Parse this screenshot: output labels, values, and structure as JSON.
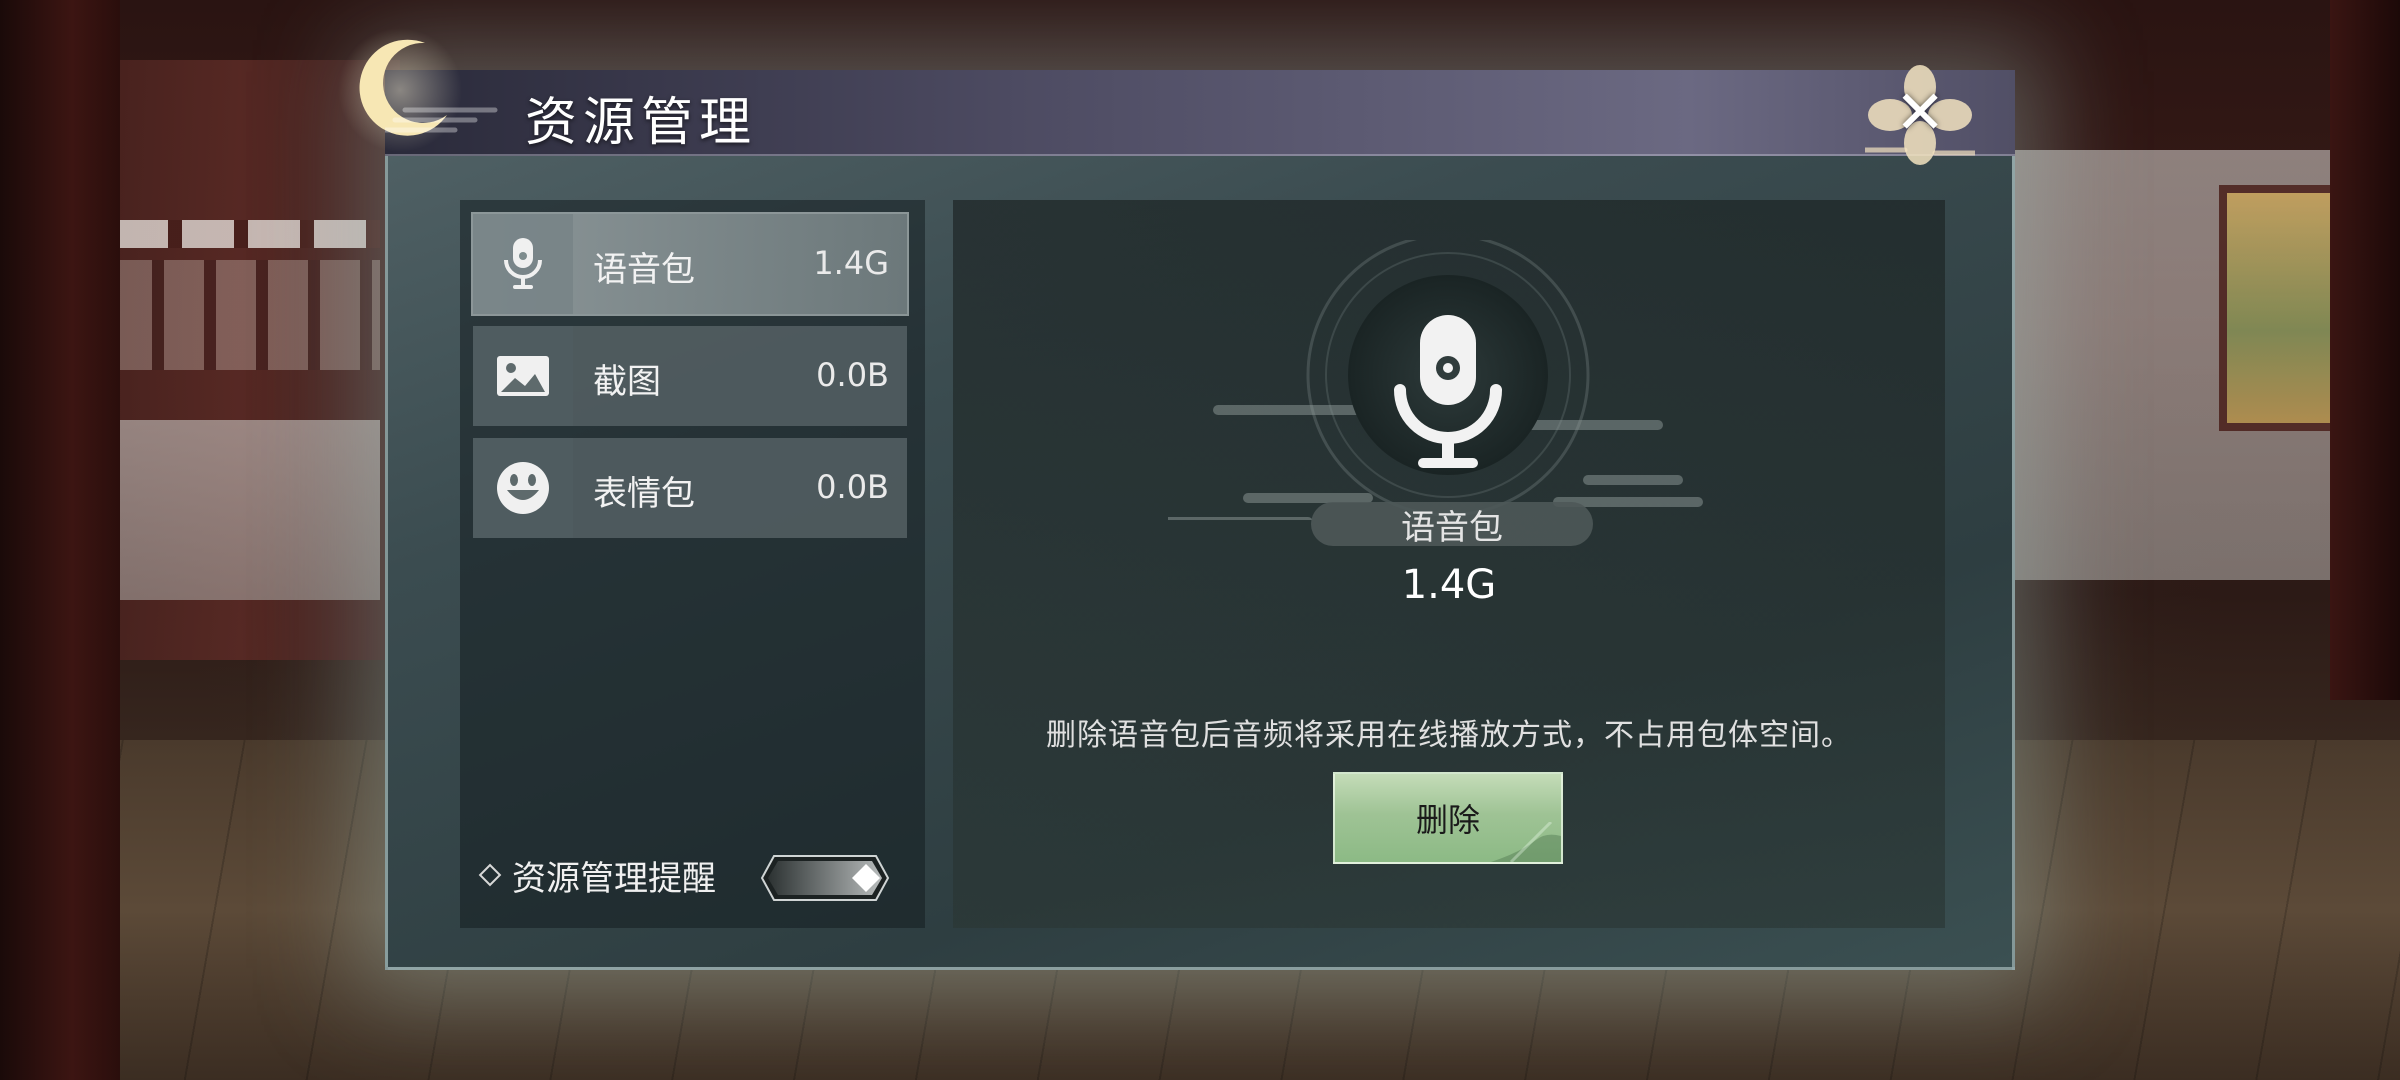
{
  "dialog": {
    "title": "资源管理",
    "close_label": "✕"
  },
  "resource_list": [
    {
      "label": "语音包",
      "size": "1.4G",
      "icon": "microphone-icon",
      "selected": true
    },
    {
      "label": "截图",
      "size": "0.0B",
      "icon": "image-icon",
      "selected": false
    },
    {
      "label": "表情包",
      "size": "0.0B",
      "icon": "smiley-icon",
      "selected": false
    }
  ],
  "reminder": {
    "label": "资源管理提醒",
    "enabled": true
  },
  "detail": {
    "name": "语音包",
    "size": "1.4G",
    "description": "删除语音包后音频将采用在线播放方式，不占用包体空间。",
    "delete_label": "删除",
    "icon": "microphone-icon"
  },
  "colors": {
    "delete_button": "#9fc395",
    "header": "#4e4c63",
    "panel": "#3b4c50"
  }
}
